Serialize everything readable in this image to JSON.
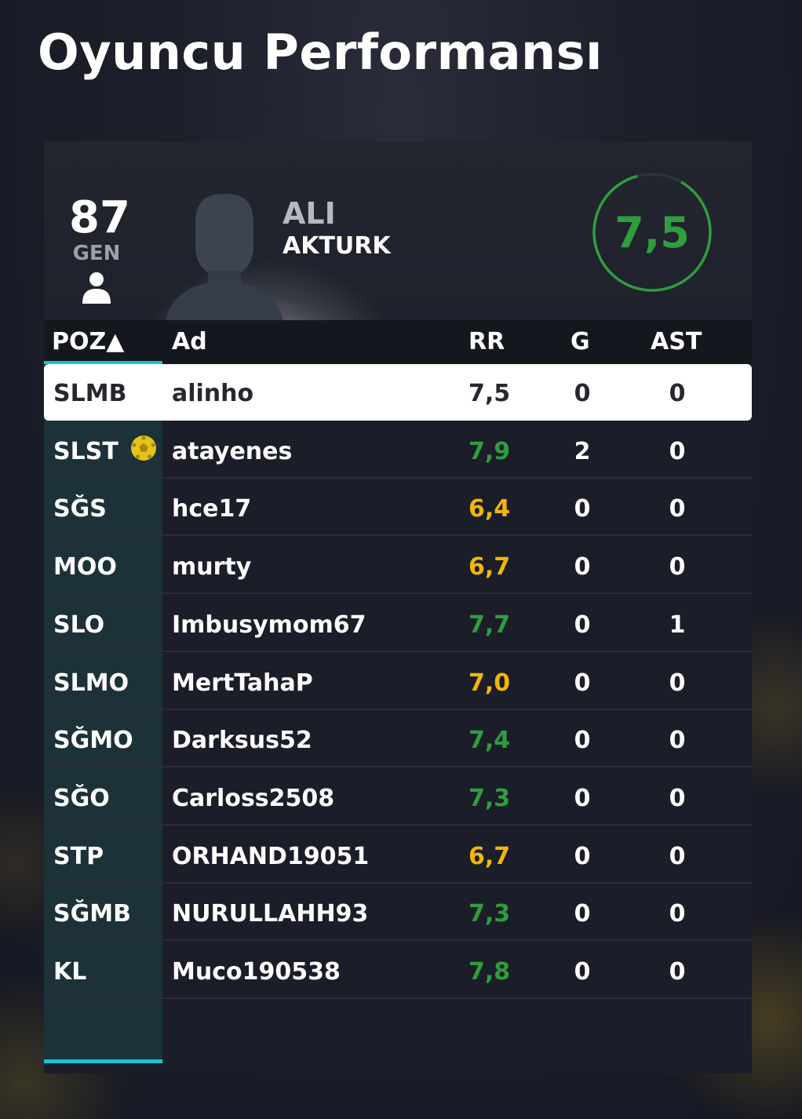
{
  "page": {
    "title": "Oyuncu Performansı"
  },
  "player": {
    "overall": "87",
    "overall_label": "GEN",
    "first_name": "ALI",
    "last_name": "AKTURK",
    "rating": "7,5",
    "icons": {
      "user": "person-icon",
      "portrait": "player-silhouette-icon"
    }
  },
  "colors": {
    "rating_green": "#2e9e3e",
    "rating_yellow": "#f2b705",
    "accent_cyan": "#19c3d4"
  },
  "table": {
    "headers": {
      "pos": "POZ▲",
      "name": "Ad",
      "rr": "RR",
      "g": "G",
      "ast": "AST"
    },
    "rows": [
      {
        "pos": "SLMB",
        "name": "alinho",
        "rr": "7,5",
        "rr_color": "neutral",
        "g": "0",
        "ast": "0",
        "selected": true
      },
      {
        "pos": "SLST",
        "name": "atayenes",
        "rr": "7,9",
        "rr_color": "green",
        "g": "2",
        "ast": "0",
        "icon": "ball-icon"
      },
      {
        "pos": "SĞS",
        "name": "hce17",
        "rr": "6,4",
        "rr_color": "yellow",
        "g": "0",
        "ast": "0"
      },
      {
        "pos": "MOO",
        "name": "murty",
        "rr": "6,7",
        "rr_color": "yellow",
        "g": "0",
        "ast": "0"
      },
      {
        "pos": "SLO",
        "name": "Imbusymom67",
        "rr": "7,7",
        "rr_color": "green",
        "g": "0",
        "ast": "1"
      },
      {
        "pos": "SLMO",
        "name": "MertTahaP",
        "rr": "7,0",
        "rr_color": "yellow",
        "g": "0",
        "ast": "0"
      },
      {
        "pos": "SĞMO",
        "name": "Darksus52",
        "rr": "7,4",
        "rr_color": "green",
        "g": "0",
        "ast": "0"
      },
      {
        "pos": "SĞO",
        "name": "Carloss2508",
        "rr": "7,3",
        "rr_color": "green",
        "g": "0",
        "ast": "0"
      },
      {
        "pos": "STP",
        "name": "ORHAND19051",
        "rr": "6,7",
        "rr_color": "yellow",
        "g": "0",
        "ast": "0"
      },
      {
        "pos": "SĞMB",
        "name": "NURULLAHH93",
        "rr": "7,3",
        "rr_color": "green",
        "g": "0",
        "ast": "0"
      },
      {
        "pos": "KL",
        "name": "Muco190538",
        "rr": "7,8",
        "rr_color": "green",
        "g": "0",
        "ast": "0"
      }
    ]
  }
}
